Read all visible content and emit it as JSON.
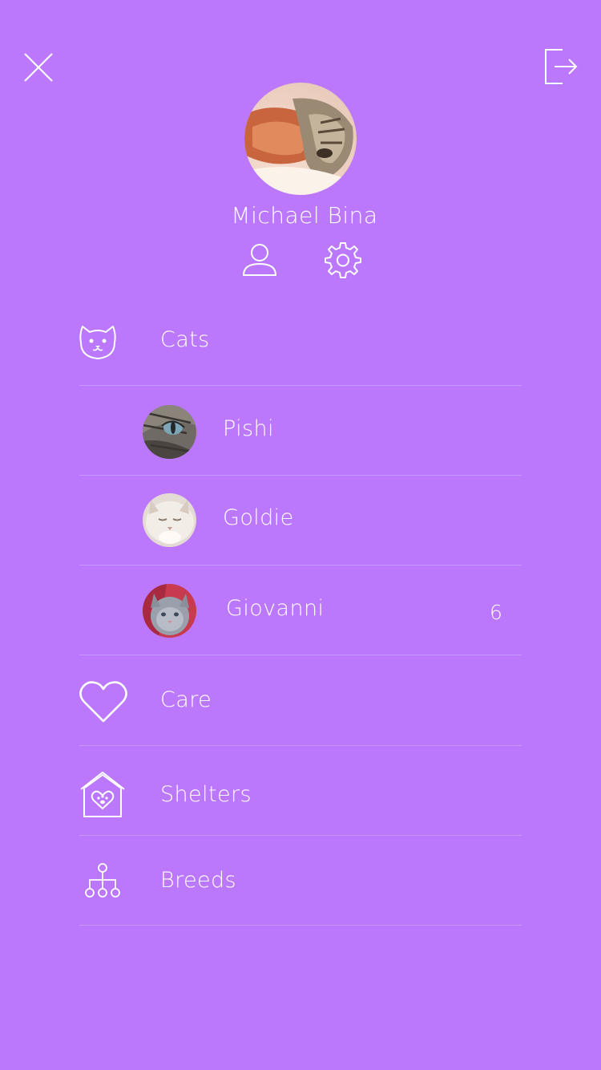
{
  "user": {
    "name": "Michael Bina"
  },
  "header": {
    "close_icon": "close-icon",
    "logout_icon": "logout-icon"
  },
  "profile_actions": {
    "profile_icon": "person-icon",
    "settings_icon": "gear-icon"
  },
  "menu": {
    "cats": {
      "label": "Cats",
      "icon": "cat-face-icon"
    },
    "care": {
      "label": "Care",
      "icon": "heart-icon"
    },
    "shelters": {
      "label": "Shelters",
      "icon": "shelter-house-icon"
    },
    "breeds": {
      "label": "Breeds",
      "icon": "hierarchy-icon"
    }
  },
  "cats": [
    {
      "name": "Pishi",
      "badge": ""
    },
    {
      "name": "Goldie",
      "badge": ""
    },
    {
      "name": "Giovanni",
      "badge": "6"
    }
  ],
  "colors": {
    "background": "#bb78fd",
    "text": "#ffffff",
    "divider": "rgba(255,255,255,0.22)"
  }
}
